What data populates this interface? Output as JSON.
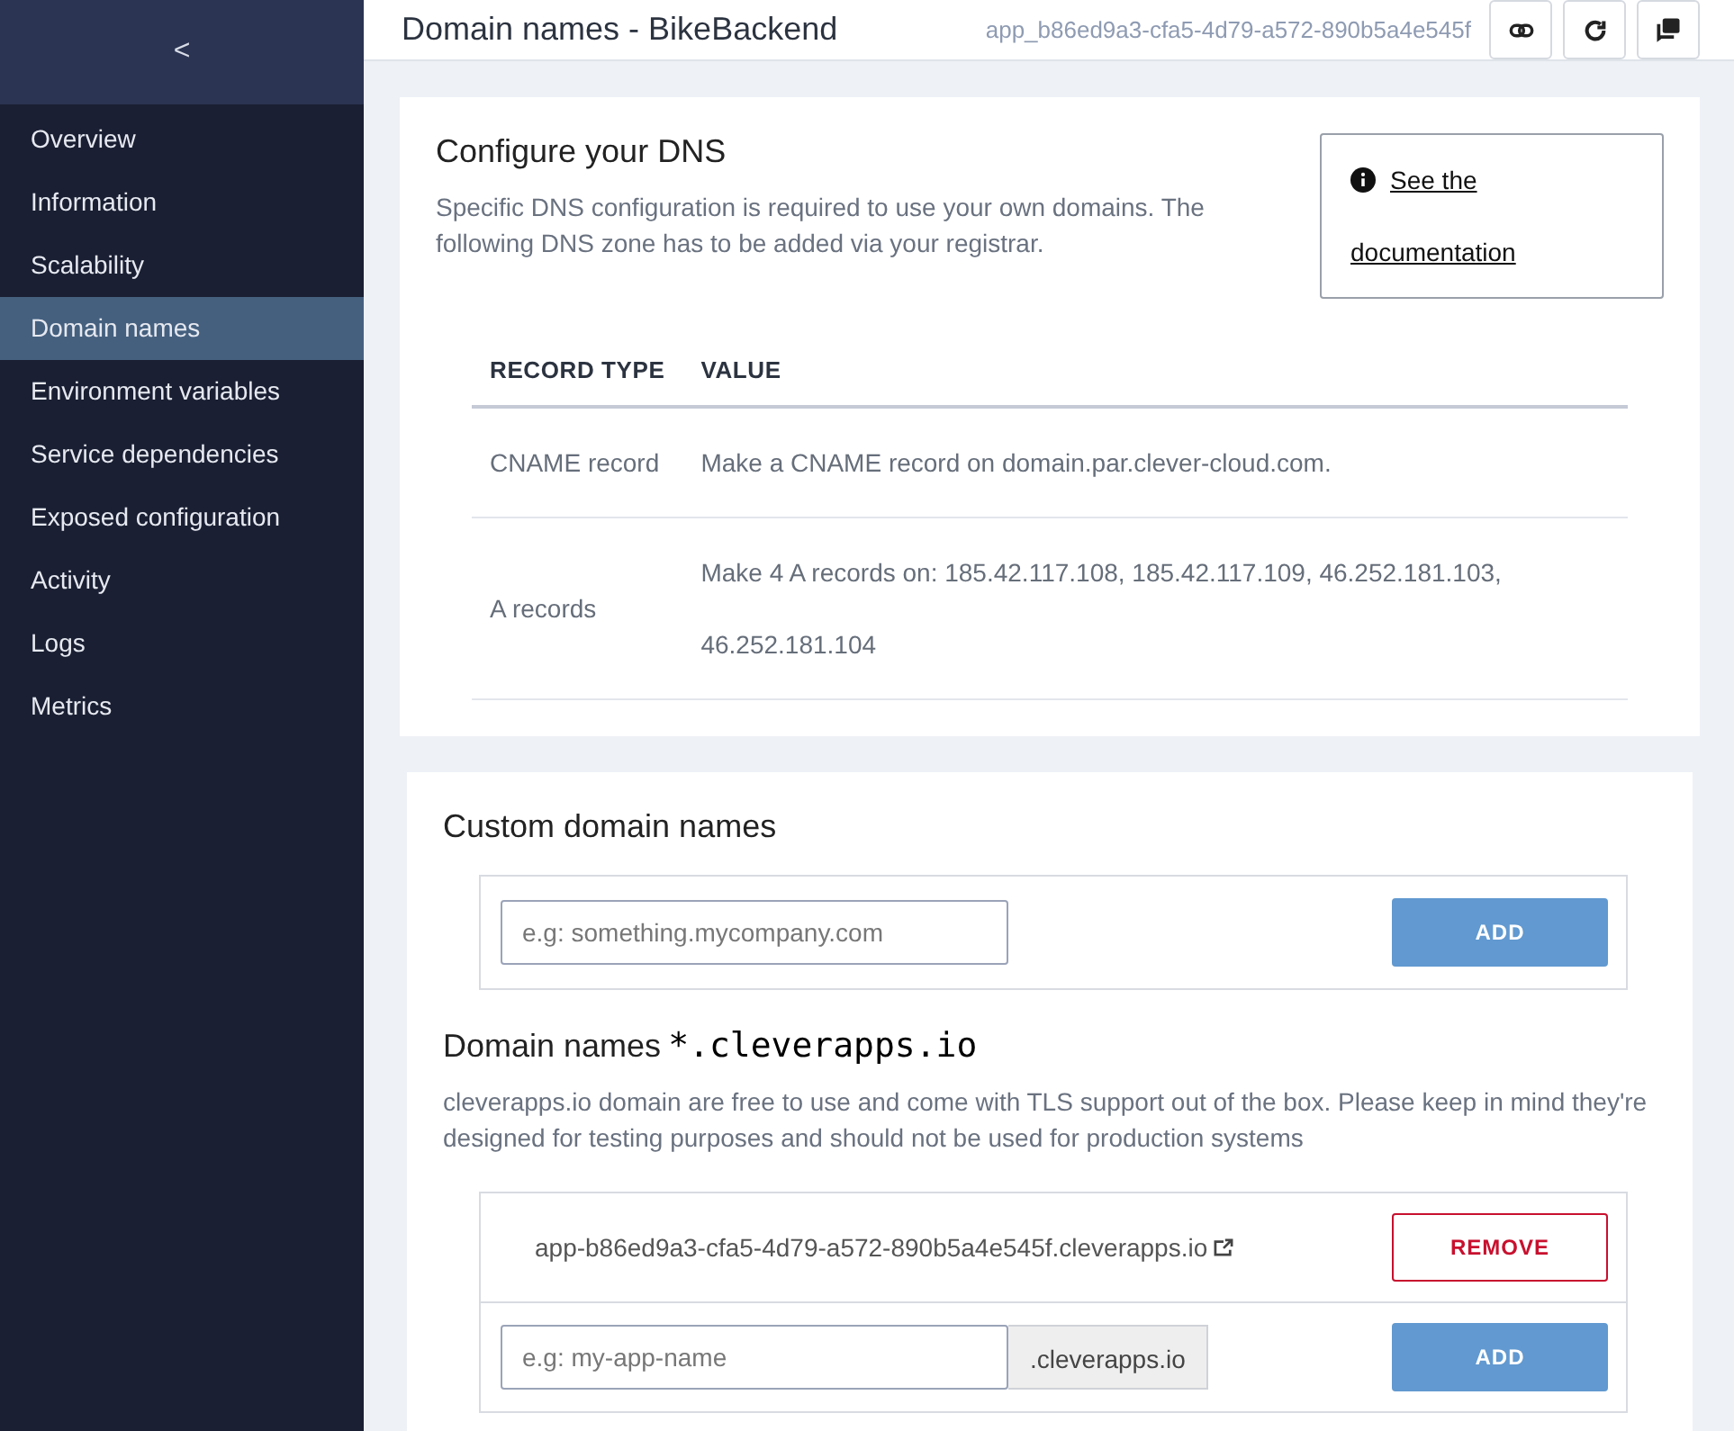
{
  "sidebar": {
    "back": "<",
    "items": [
      {
        "label": "Overview",
        "selected": false
      },
      {
        "label": "Information",
        "selected": false
      },
      {
        "label": "Scalability",
        "selected": false
      },
      {
        "label": "Domain names",
        "selected": true
      },
      {
        "label": "Environment variables",
        "selected": false
      },
      {
        "label": "Service dependencies",
        "selected": false
      },
      {
        "label": "Exposed configuration",
        "selected": false
      },
      {
        "label": "Activity",
        "selected": false
      },
      {
        "label": "Logs",
        "selected": false
      },
      {
        "label": "Metrics",
        "selected": false
      }
    ]
  },
  "header": {
    "title": "Domain names - BikeBackend",
    "app_id": "app_b86ed9a3-cfa5-4d79-a572-890b5a4e545f"
  },
  "dns": {
    "title": "Configure your DNS",
    "description": "Specific DNS configuration is required to use your own domains. The following DNS zone has to be added via your registrar.",
    "doc_link": "See the documentation",
    "columns": [
      "RECORD TYPE",
      "VALUE"
    ],
    "rows": [
      {
        "type": "CNAME record",
        "value": "Make a CNAME record on domain.par.clever-cloud.com."
      },
      {
        "type": "A records",
        "value": "Make 4 A records on: 185.42.117.108, 185.42.117.109, 46.252.181.103, 46.252.181.104"
      }
    ]
  },
  "custom": {
    "title": "Custom domain names",
    "placeholder": "e.g: something.mycompany.com",
    "button": "ADD"
  },
  "cleverapps": {
    "title": "Domain names",
    "suffix": "*.cleverapps.io",
    "description": "cleverapps.io domain are free to use and come with TLS support out of the box. Please keep in mind they're designed for testing purposes and should not be used for production systems",
    "domain": "app-b86ed9a3-cfa5-4d79-a572-890b5a4e545f.cleverapps.io",
    "remove": "REMOVE",
    "placeholder": "e.g: my-app-name",
    "addon": ".cleverapps.io",
    "button": "ADD"
  }
}
